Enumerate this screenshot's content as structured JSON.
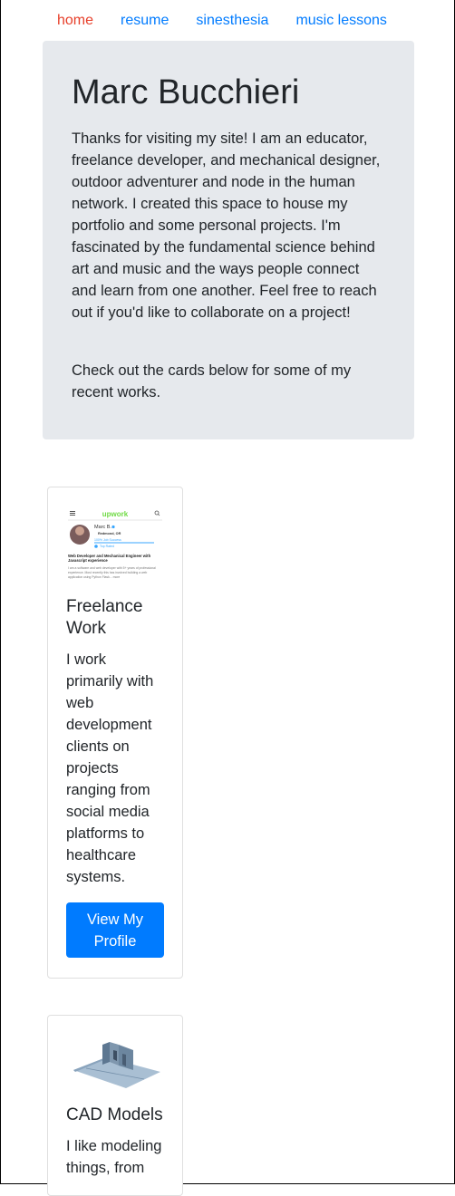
{
  "nav": {
    "items": [
      {
        "label": "home",
        "active": true
      },
      {
        "label": "resume"
      },
      {
        "label": "sinesthesia"
      },
      {
        "label": "music lessons"
      }
    ]
  },
  "hero": {
    "title": "Marc Bucchieri",
    "intro": "Thanks for visiting my site! I am an educator, freelance developer, and mechanical designer, outdoor adventurer and node in the human network. I created this space to house my portfolio and some personal projects. I'm fascinated by the fundamental science behind art and music and the ways people connect and learn from one another. Feel free to reach out if you'd like to collaborate on a project!",
    "cta": "Check out the cards below for some of my recent works."
  },
  "cards": [
    {
      "title": "Freelance Work",
      "text": "I work primarily with web development clients on projects ranging from social media platforms to healthcare systems.",
      "button": "View My Profile",
      "image": {
        "brand": "upwork",
        "name": "Marc B.",
        "location": "Redmond, OR",
        "job_success": "100% Job Success",
        "badge": "Top Rated",
        "headline": "Web Developer and Mechanical Engineer with Javascript experience",
        "blurb": "I am a software and web developer with 5+ years of professional experience. Most recently this has involved building a web application using Python Flask... more"
      }
    },
    {
      "title": "CAD Models",
      "text": "I like modeling things, from"
    }
  ],
  "colors": {
    "link": "#007bff",
    "active_link": "#e7402b",
    "jumbotron_bg": "#e6e9ed",
    "button_bg": "#007bff",
    "upwork_green": "#6fda44"
  }
}
